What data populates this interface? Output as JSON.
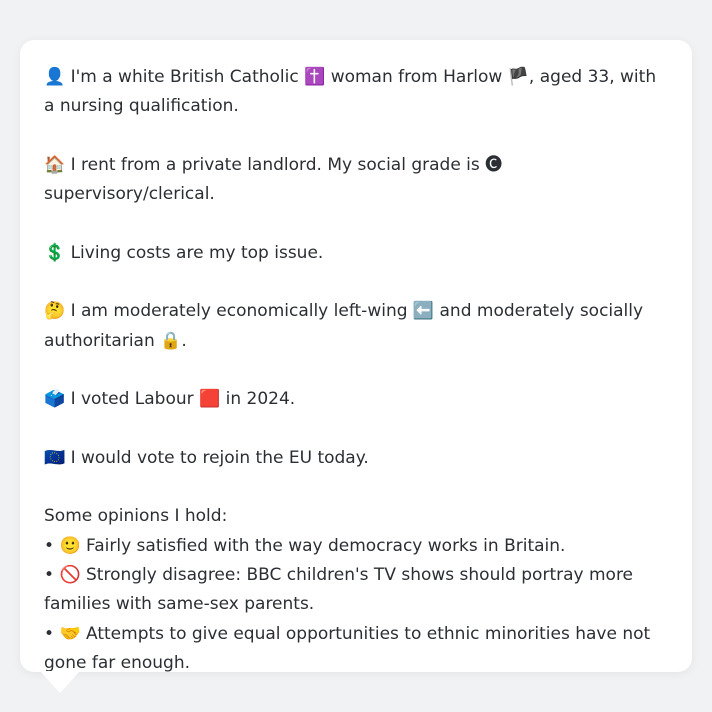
{
  "profile": {
    "identity": {
      "icon": "👤",
      "text_1": "I'm a white British Catholic",
      "icon_faith": "✝️",
      "text_2": "woman from Harlow",
      "icon_flag": "🏴",
      "text_3": ", aged 33, with a nursing qualification."
    },
    "housing": {
      "icon": "🏠",
      "text_1": "I rent from a private landlord. My social grade is",
      "icon_grade": "🅒",
      "text_2": "supervisory/clerical."
    },
    "issue": {
      "icon": "💲",
      "text": "Living costs are my top issue."
    },
    "politics": {
      "icon": "🤔",
      "text_1": "I am moderately economically left-wing",
      "icon_left": "⬅️",
      "text_2": "and moderately socially authoritarian",
      "icon_lock": "🔒",
      "text_3": "."
    },
    "vote": {
      "icon": "🗳️",
      "text_1": "I voted Labour",
      "icon_party": "🟥",
      "text_2": "in 2024."
    },
    "eu": {
      "icon": "🇪🇺",
      "text": "I would vote to rejoin the EU today."
    },
    "opinions": {
      "heading": "Some opinions I hold:",
      "items": [
        {
          "bullet": "•",
          "icon": "🙂",
          "text": "Fairly satisfied with the way democracy works in Britain."
        },
        {
          "bullet": "•",
          "icon": "🚫",
          "text": "Strongly disagree: BBC children's TV shows should portray more families with same-sex parents."
        },
        {
          "bullet": "•",
          "icon": "🤝",
          "text": "Attempts to give equal opportunities to ethnic minorities have not gone far enough."
        }
      ]
    }
  }
}
